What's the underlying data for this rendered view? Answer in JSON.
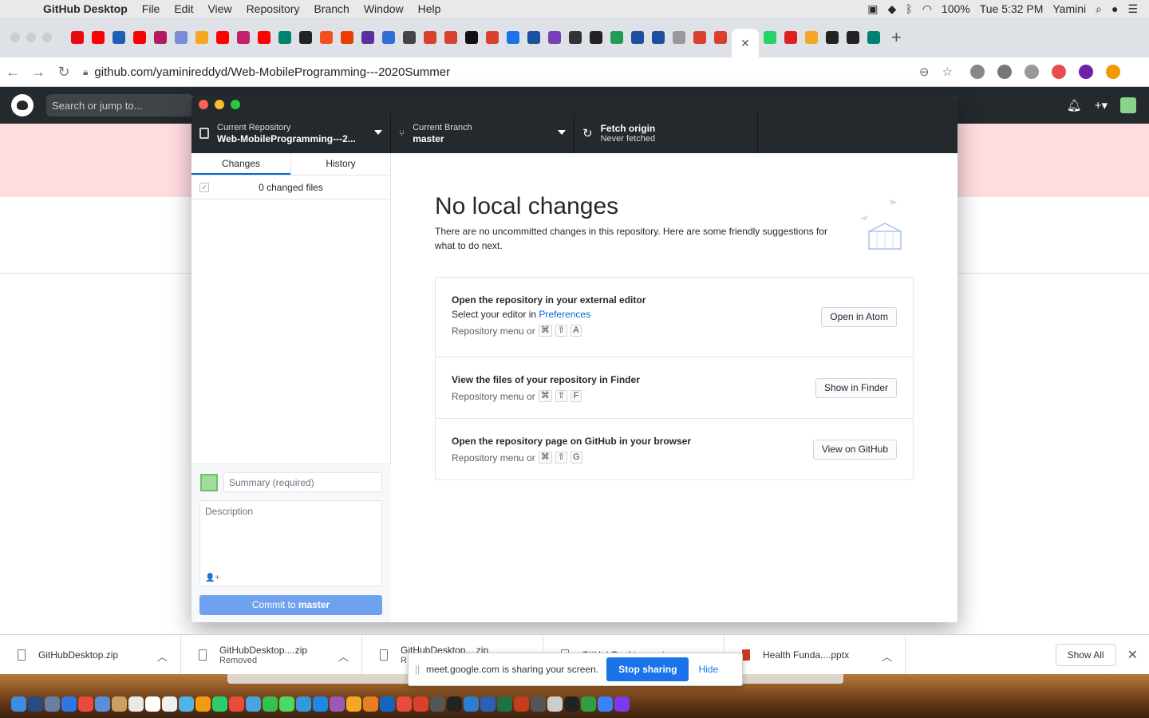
{
  "mac_menu": {
    "app_name": "GitHub Desktop",
    "items": [
      "File",
      "Edit",
      "View",
      "Repository",
      "Branch",
      "Window",
      "Help"
    ],
    "battery": "100%",
    "clock": "Tue 5:32 PM",
    "user": "Yamini"
  },
  "browser": {
    "url": "github.com/yaminireddyd/Web-MobileProgramming---2020Summer",
    "active_tab_close": "✕",
    "new_tab": "+"
  },
  "github_header": {
    "search_placeholder": "Search or jump to..."
  },
  "app": {
    "toolbar": {
      "repo_label": "Current Repository",
      "repo_value": "Web-MobileProgramming---2...",
      "branch_label": "Current Branch",
      "branch_value": "master",
      "fetch_label": "Fetch origin",
      "fetch_value": "Never fetched"
    },
    "tabs": {
      "changes": "Changes",
      "history": "History"
    },
    "changed_files": "0 changed files",
    "commit": {
      "summary_placeholder": "Summary (required)",
      "description_placeholder": "Description",
      "button_prefix": "Commit to ",
      "button_branch": "master"
    },
    "main": {
      "heading": "No local changes",
      "subtext": "There are no uncommitted changes in this repository. Here are some friendly suggestions for what to do next.",
      "suggestions": [
        {
          "title": "Open the repository in your external editor",
          "sub_prefix": "Select your editor in ",
          "sub_link": "Preferences",
          "shortcut_prefix": "Repository menu or",
          "keys": [
            "⌘",
            "⇧",
            "A"
          ],
          "button": "Open in Atom"
        },
        {
          "title": "View the files of your repository in Finder",
          "shortcut_prefix": "Repository menu or",
          "keys": [
            "⌘",
            "⇧",
            "F"
          ],
          "button": "Show in Finder"
        },
        {
          "title": "Open the repository page on GitHub in your browser",
          "shortcut_prefix": "Repository menu or",
          "keys": [
            "⌘",
            "⇧",
            "G"
          ],
          "button": "View on GitHub"
        }
      ]
    }
  },
  "downloads": [
    {
      "name": "GitHubDesktop.zip",
      "status": ""
    },
    {
      "name": "GitHubDesktop....zip",
      "status": "Removed"
    },
    {
      "name": "GitHubDesktop....zip",
      "status": "R"
    },
    {
      "name": "GitHubDesktop....zip",
      "status": ""
    },
    {
      "name": "Health Funda....pptx",
      "status": ""
    }
  ],
  "downloads_show_all": "Show All",
  "screen_share": {
    "message": "meet.google.com is sharing your screen.",
    "stop": "Stop sharing",
    "hide": "Hide"
  },
  "colors": {
    "gh_dark": "#24292e",
    "accent_blue": "#0366d6",
    "commit_button": "#6fa2ee",
    "pink_band": "#ffdce0",
    "share_blue": "#1a73e8"
  }
}
